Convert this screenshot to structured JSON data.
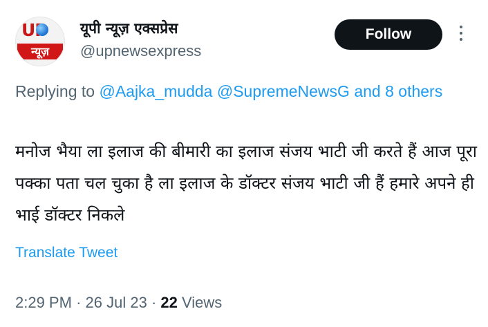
{
  "author": {
    "avatar_logo_top": "UP",
    "avatar_logo_bottom": "न्यूज़",
    "display_name": "यूपी न्यूज़ एक्सप्रेस",
    "handle": "@upnewsexpress"
  },
  "follow_label": "Follow",
  "reply": {
    "prefix": "Replying to ",
    "mention_1": "@Aajka_mudda",
    "mention_2": "@SupremeNewsG",
    "others": "and 8 others"
  },
  "tweet_text": "मनोज भैया ला इलाज की बीमारी का इलाज संजय भाटी जी करते हैं आज पूरा पक्का पता चल चुका है ला इलाज के डॉक्टर संजय भाटी जी हैं हमारे अपने ही भाई डॉक्टर निकले",
  "translate_label": "Translate Tweet",
  "meta": {
    "time": "2:29 PM",
    "separator": "·",
    "date": "26 Jul 23",
    "views_count": "22",
    "views_label": "Views"
  },
  "colors": {
    "link": "#1d9bf0",
    "secondary_text": "#536471",
    "primary_text": "#0f1419",
    "button_bg": "#0f1419"
  },
  "icons": {
    "more": "more-horizontal-icon"
  }
}
